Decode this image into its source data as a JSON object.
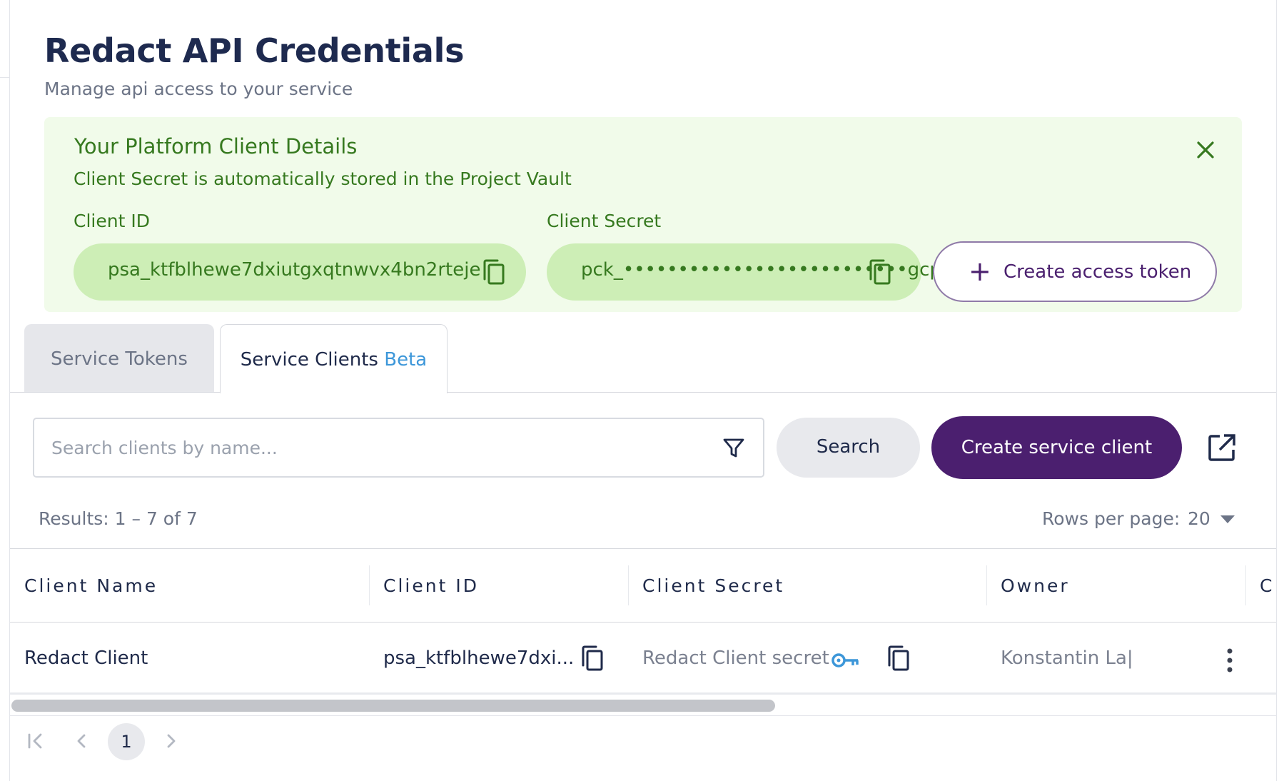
{
  "header": {
    "title": "Redact API Credentials",
    "subtitle": "Manage api access to your service"
  },
  "banner": {
    "title": "Your Platform Client Details",
    "note": "Client Secret is automatically stored in the Project Vault",
    "client_id_label": "Client ID",
    "client_id_value": "psa_ktfblhewe7dxiutgxqtnwvx4bn2rteje",
    "client_secret_label": "Client Secret",
    "client_secret_value": "pck_••••••••••••••••••••••••••gcpr",
    "create_token_label": "Create access token"
  },
  "tabs": [
    {
      "label": "Service Tokens",
      "active": false
    },
    {
      "label": "Service Clients",
      "badge": "Beta",
      "active": true
    }
  ],
  "search": {
    "placeholder": "Search clients by name...",
    "button_label": "Search",
    "create_label": "Create service client"
  },
  "results": {
    "summary": "Results: 1 – 7 of 7",
    "rows_per_page_label": "Rows per page:",
    "rows_per_page_value": "20"
  },
  "table": {
    "columns": [
      "Client Name",
      "Client ID",
      "Client Secret",
      "Owner",
      "C"
    ],
    "rows": [
      {
        "client_name": "Redact Client",
        "client_id": "psa_ktfblhewe7dxi...",
        "client_secret": "Redact Client secret",
        "owner": "Konstantin La|"
      }
    ]
  },
  "pagination": {
    "current_page": "1"
  },
  "colors": {
    "brand_purple": "#4b1f6f",
    "success_green": "#36791f",
    "banner_bg": "#f1fbea",
    "pill_bg": "#cdeeb6",
    "beta_blue": "#3d97d9",
    "title_navy": "#1e2a4f"
  },
  "icons": [
    "close-icon",
    "copy-icon",
    "plus-icon",
    "filter-icon",
    "external-link-icon",
    "key-icon",
    "more-vertical-icon",
    "first-page-icon",
    "prev-page-icon",
    "next-page-icon"
  ]
}
